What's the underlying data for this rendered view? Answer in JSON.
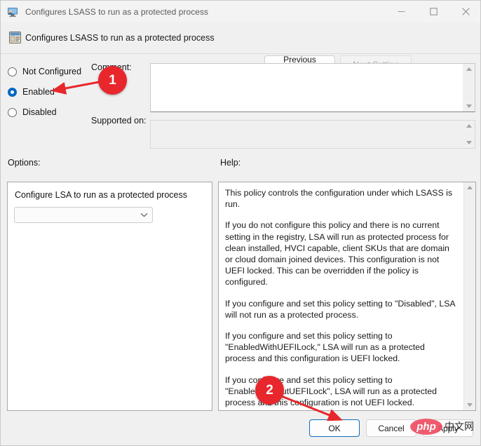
{
  "window": {
    "title": "Configures LSASS to run as a protected process",
    "controls": {
      "minimize": "minimize-icon",
      "maximize": "maximize-icon",
      "close": "close-icon"
    }
  },
  "header": {
    "title": "Configures LSASS to run as a protected process",
    "previous_setting": "Previous Setting",
    "next_setting": "Next Setting"
  },
  "state_options": [
    {
      "label": "Not Configured",
      "selected": false
    },
    {
      "label": "Enabled",
      "selected": true
    },
    {
      "label": "Disabled",
      "selected": false
    }
  ],
  "fields": {
    "comment_label": "Comment:",
    "comment_value": "",
    "supported_label": "Supported on:",
    "supported_value": ""
  },
  "options": {
    "section_label": "Options:",
    "setting_title": "Configure LSA to run as a protected process",
    "dropdown_value": ""
  },
  "help": {
    "section_label": "Help:",
    "paragraphs": [
      "This policy controls the configuration under which LSASS is run.",
      "If you do not configure this policy and there is no current setting in the registry, LSA will run as protected process for clean installed, HVCI capable, client SKUs that are domain or cloud domain joined devices. This configuration is not UEFI locked. This can be overridden if the policy is configured.",
      "If you configure and set this policy setting to \"Disabled\", LSA will not run as a protected process.",
      "If you configure and set this policy setting to \"EnabledWithUEFILock,\" LSA will run as a protected process and this configuration is UEFI locked.",
      "If you configure and set this policy setting to \"EnabledWithoutUEFILock\", LSA will run as a protected process and this configuration is not UEFI locked."
    ]
  },
  "footer": {
    "ok": "OK",
    "cancel": "Cancel",
    "apply": "Apply"
  },
  "annotations": [
    {
      "number": "1",
      "target": "enabled-radio"
    },
    {
      "number": "2",
      "target": "ok-button"
    }
  ],
  "watermark": {
    "logo_text": "php",
    "site_text": "中文网"
  },
  "colors": {
    "accent": "#0067c0",
    "annotation_red": "#e8272c",
    "window_bg": "#f0f0f0",
    "focus_border": "#0f6cbd"
  }
}
